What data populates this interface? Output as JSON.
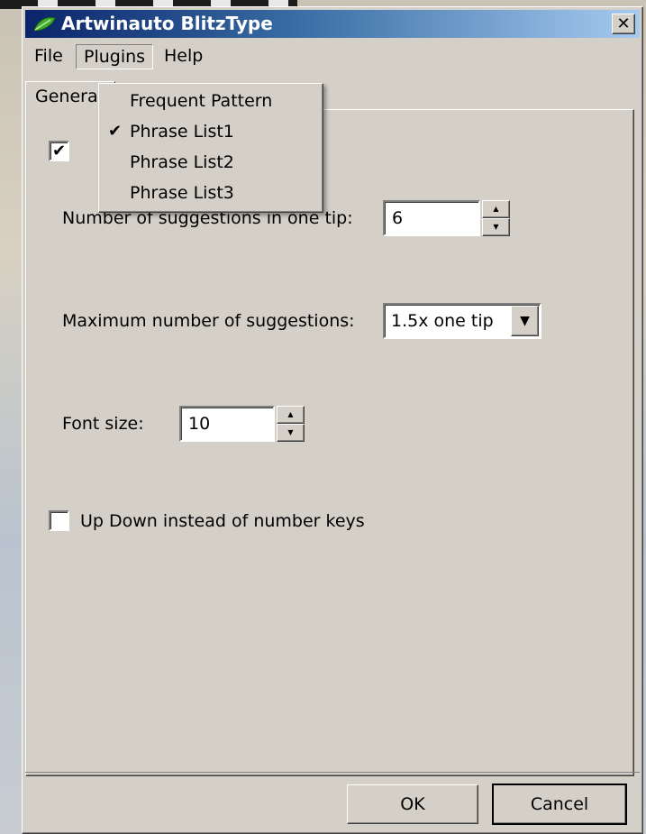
{
  "window": {
    "title": "Artwinauto BlitzType",
    "close_glyph": "✕"
  },
  "menubar": {
    "items": [
      {
        "label": "File"
      },
      {
        "label": "Plugins"
      },
      {
        "label": "Help"
      }
    ]
  },
  "plugins_menu": {
    "items": [
      {
        "label": "Frequent Pattern",
        "checked": false
      },
      {
        "label": "Phrase List1",
        "checked": true
      },
      {
        "label": "Phrase List2",
        "checked": false
      },
      {
        "label": "Phrase List3",
        "checked": false
      }
    ]
  },
  "tabs": {
    "active_label": "General"
  },
  "general": {
    "enable_checkbox": {
      "checked": true
    },
    "suggestions_in_tip": {
      "label": "Number of suggestions in one tip:",
      "value": "6"
    },
    "max_suggestions": {
      "label": "Maximum number of suggestions:",
      "value": "1.5x one tip"
    },
    "font_size": {
      "label": "Font size:",
      "value": "10"
    },
    "updown_keys": {
      "label": "Up Down instead of number keys",
      "checked": false
    }
  },
  "buttons": {
    "ok": "OK",
    "cancel": "Cancel"
  },
  "icons": {
    "app": "leaf-icon",
    "check": "✔",
    "spin_up": "▲",
    "spin_down": "▼",
    "combo_arrow": "▼"
  }
}
